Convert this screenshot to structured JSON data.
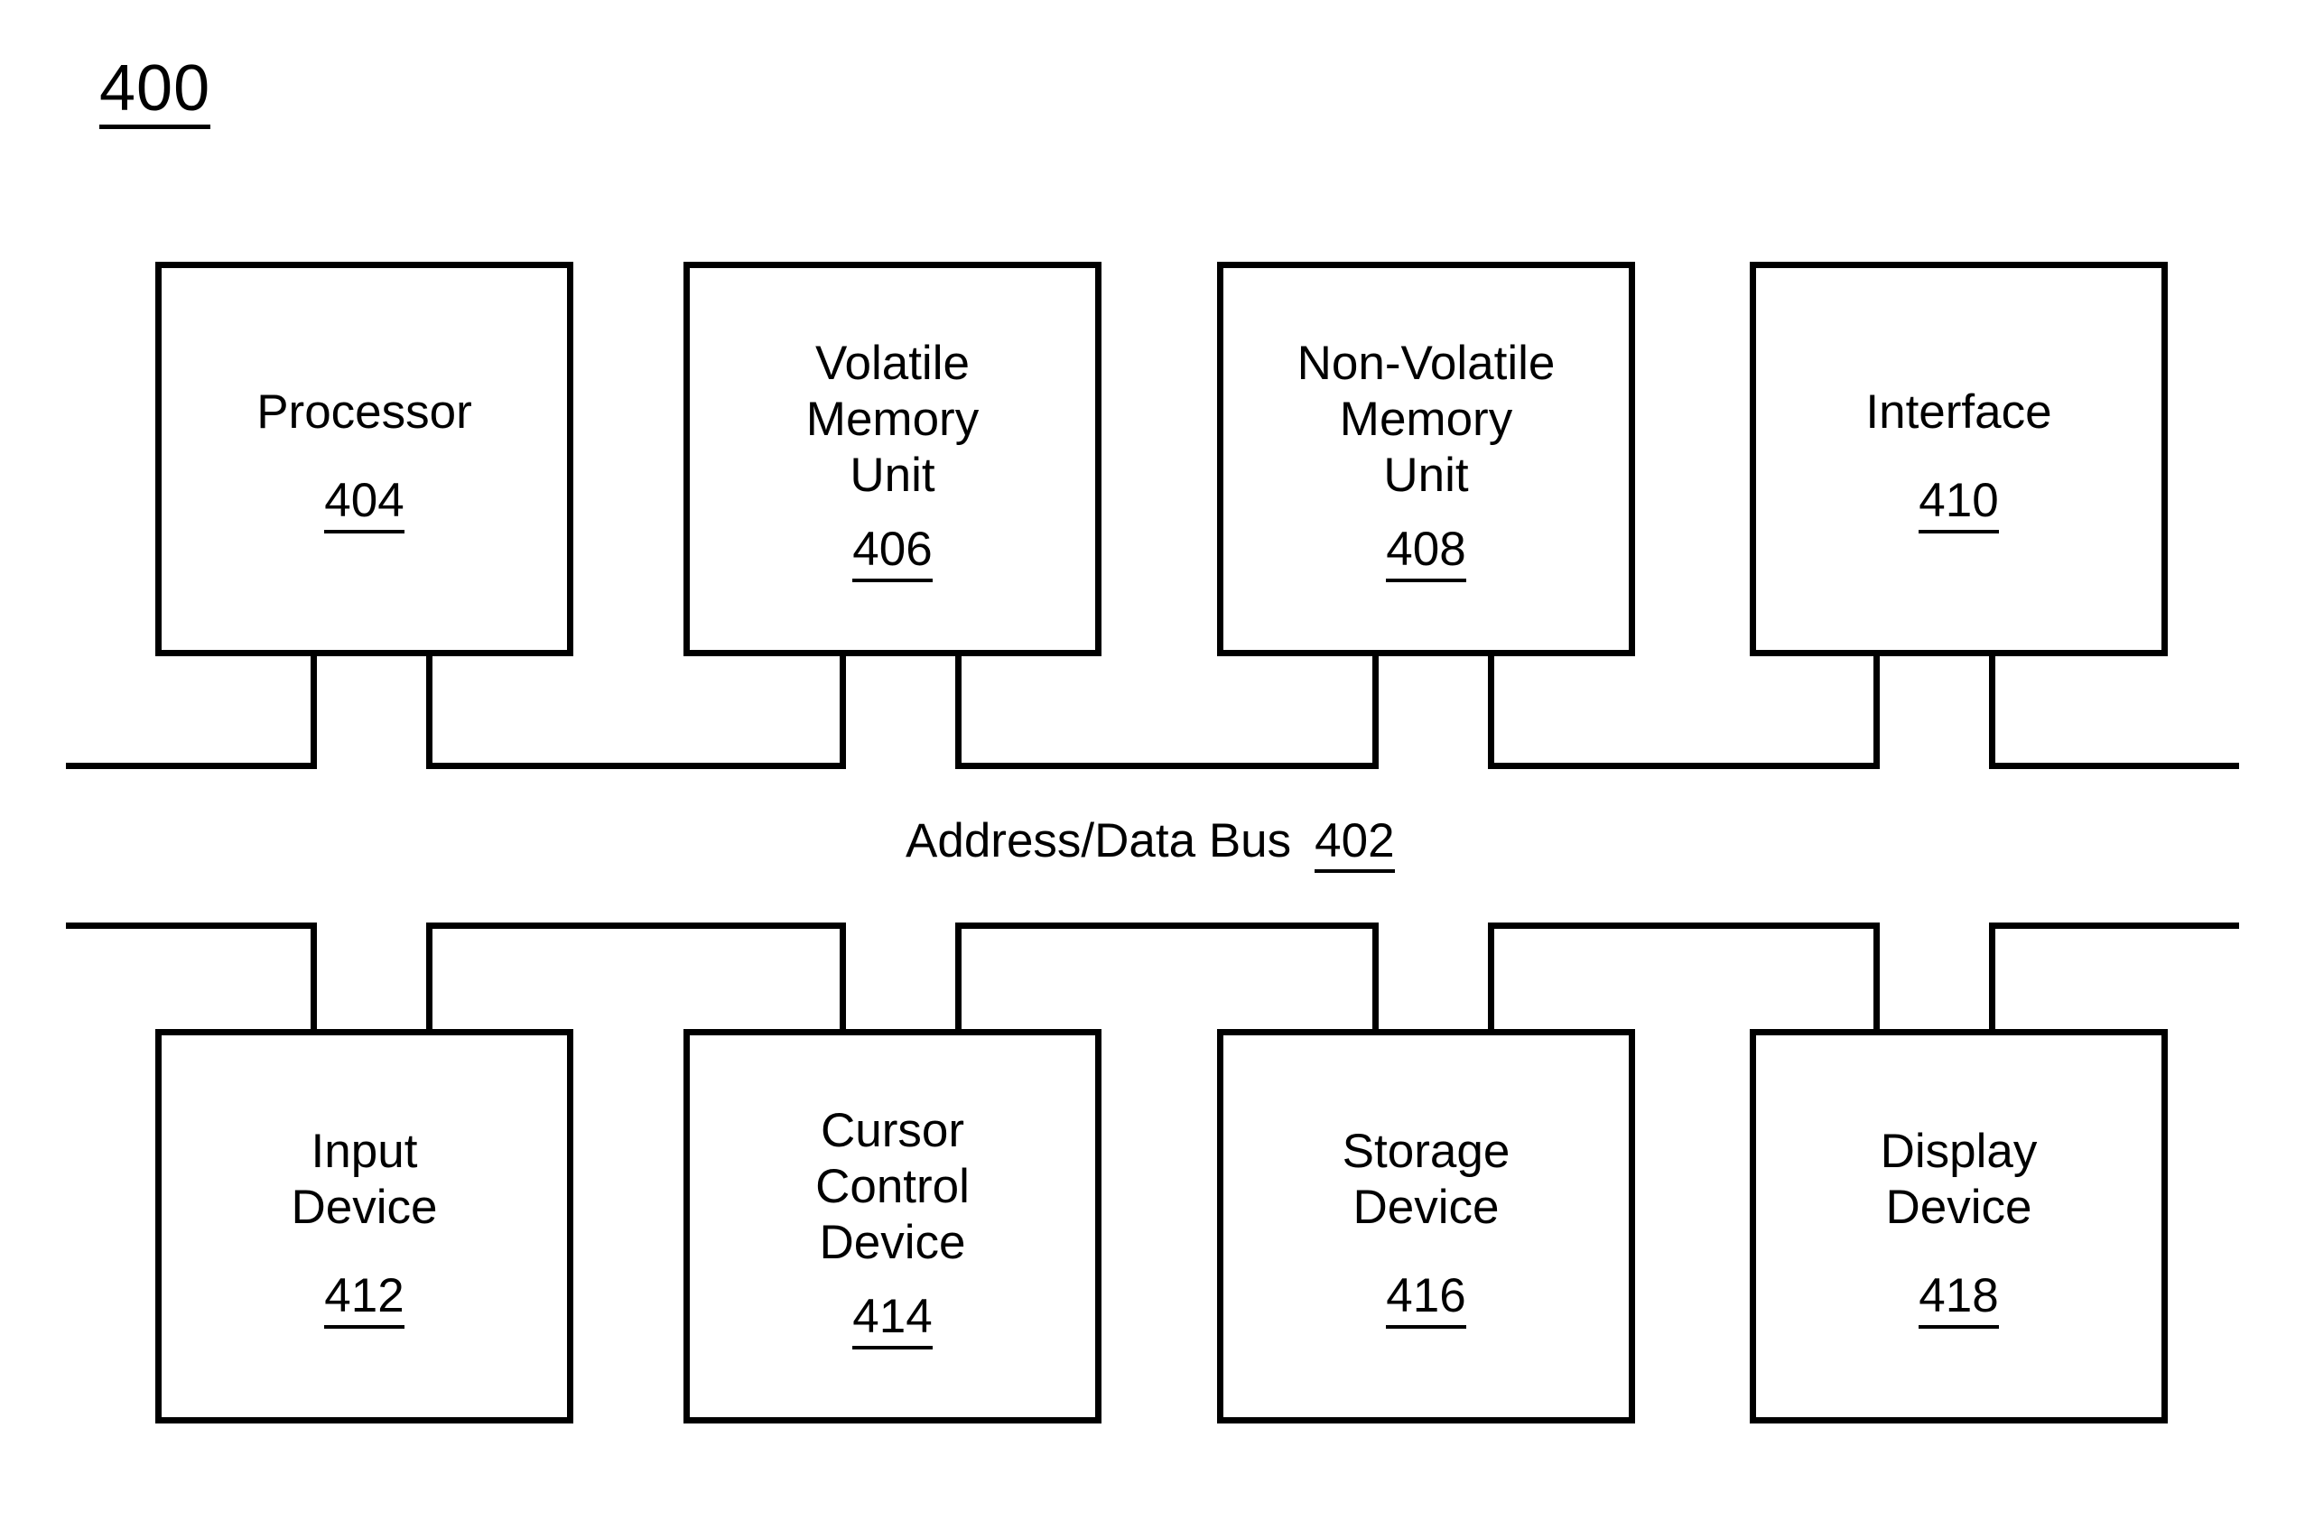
{
  "figure": {
    "number": "400"
  },
  "bus": {
    "label": "Address/Data Bus",
    "ref": "402"
  },
  "top_row": [
    {
      "name": "processor",
      "label": "Processor",
      "ref": "404"
    },
    {
      "name": "volatile-memory-unit",
      "label": "Volatile\nMemory\nUnit",
      "ref": "406"
    },
    {
      "name": "non-volatile-memory-unit",
      "label": "Non-Volatile\nMemory\nUnit",
      "ref": "408"
    },
    {
      "name": "interface",
      "label": "Interface",
      "ref": "410"
    }
  ],
  "bottom_row": [
    {
      "name": "input-device",
      "label": "Input\nDevice",
      "ref": "412"
    },
    {
      "name": "cursor-control-device",
      "label": "Cursor\nControl\nDevice",
      "ref": "414"
    },
    {
      "name": "storage-device",
      "label": "Storage\nDevice",
      "ref": "416"
    },
    {
      "name": "display-device",
      "label": "Display\nDevice",
      "ref": "418"
    }
  ],
  "colors": {
    "ink": "#000000",
    "background": "#ffffff"
  }
}
